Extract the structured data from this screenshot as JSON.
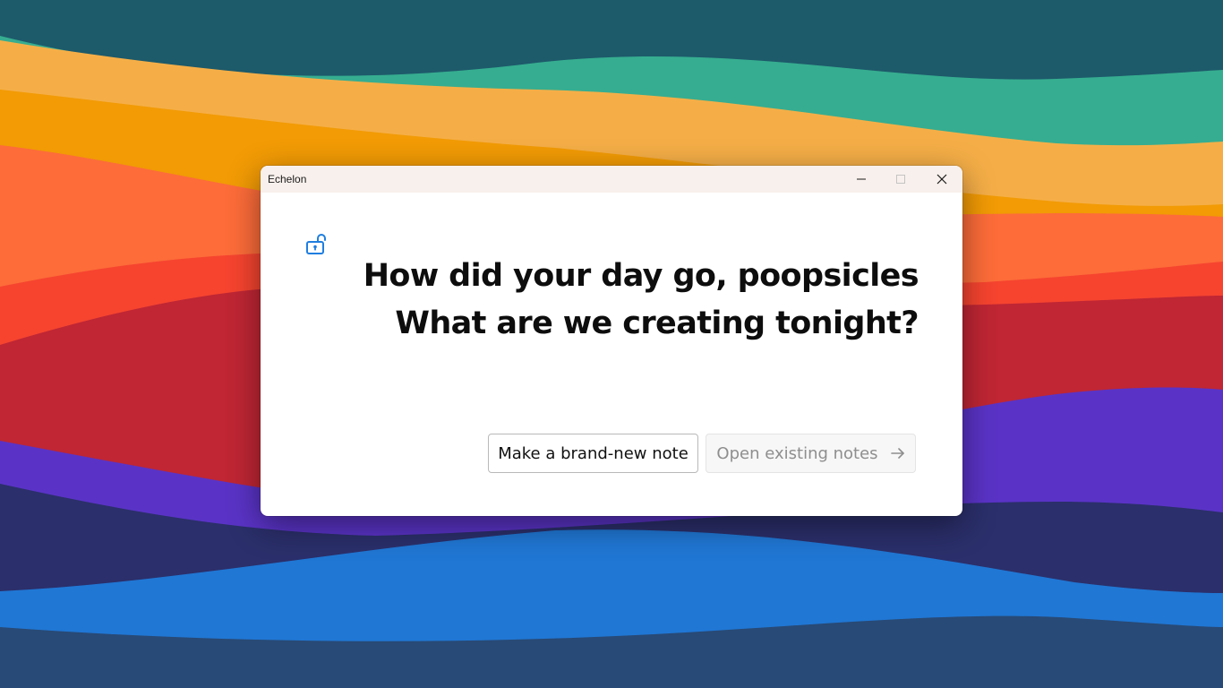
{
  "window": {
    "title": "Echelon",
    "controls": {
      "minimize": "minimize",
      "maximize": "maximize",
      "close": "close"
    }
  },
  "main": {
    "lock_icon": "unlocked-padlock-icon",
    "headline": {
      "line1": "How did your day go, poopsicles",
      "line2": "What are we creating tonight?"
    },
    "buttons": {
      "new_note_label": "Make a brand-new note",
      "open_notes_label": "Open existing notes",
      "open_notes_icon": "arrow-right-icon"
    }
  },
  "colors": {
    "accent": "#1f7ee0",
    "wallpaper": [
      "#1d5a6a",
      "#36ad90",
      "#f5ae47",
      "#f29b05",
      "#fd6c39",
      "#f6442f",
      "#c02634",
      "#5a33c6",
      "#2b2f6b",
      "#2077d4",
      "#284a76"
    ]
  }
}
